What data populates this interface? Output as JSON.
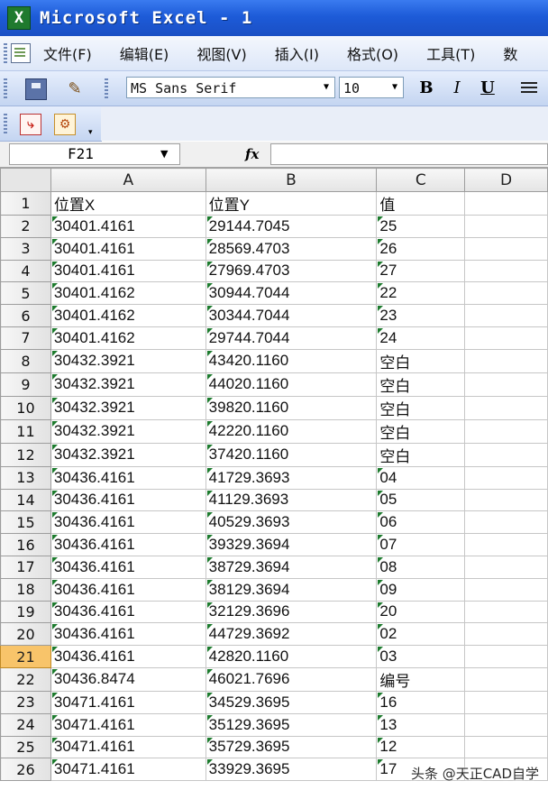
{
  "window": {
    "title": "Microsoft Excel - 1",
    "app_icon_letter": "X"
  },
  "menu": {
    "items": [
      {
        "key": "file",
        "label": "文件(F)"
      },
      {
        "key": "edit",
        "label": "编辑(E)"
      },
      {
        "key": "view",
        "label": "视图(V)"
      },
      {
        "key": "insert",
        "label": "插入(I)"
      },
      {
        "key": "format",
        "label": "格式(O)"
      },
      {
        "key": "tools",
        "label": "工具(T)"
      },
      {
        "key": "data",
        "label": "数"
      }
    ]
  },
  "toolbar": {
    "font_name": "MS Sans Serif",
    "font_size": "10",
    "bold_label": "B",
    "italic_label": "I",
    "underline_label": "U",
    "icons": [
      "save-icon",
      "format-painter-icon",
      "bold-icon",
      "italic-icon",
      "underline-icon",
      "align-icon",
      "pdf-convert-icon",
      "pdf-options-icon"
    ]
  },
  "formula_bar": {
    "name_box": "F21",
    "fx_label": "fx",
    "formula": ""
  },
  "sheet": {
    "columns": [
      "A",
      "B",
      "C",
      "D"
    ],
    "active_row": "21",
    "rows": [
      {
        "n": "1",
        "a": "位置X",
        "b": "位置Y",
        "c": "值",
        "d": "",
        "hdr": true
      },
      {
        "n": "2",
        "a": "30401.4161",
        "b": "29144.7045",
        "c": "25",
        "d": ""
      },
      {
        "n": "3",
        "a": "30401.4161",
        "b": "28569.4703",
        "c": "26",
        "d": ""
      },
      {
        "n": "4",
        "a": "30401.4161",
        "b": "27969.4703",
        "c": "27",
        "d": ""
      },
      {
        "n": "5",
        "a": "30401.4162",
        "b": "30944.7044",
        "c": "22",
        "d": ""
      },
      {
        "n": "6",
        "a": "30401.4162",
        "b": "30344.7044",
        "c": "23",
        "d": ""
      },
      {
        "n": "7",
        "a": "30401.4162",
        "b": "29744.7044",
        "c": "24",
        "d": ""
      },
      {
        "n": "8",
        "a": "30432.3921",
        "b": "43420.1160",
        "c": "空白",
        "d": ""
      },
      {
        "n": "9",
        "a": "30432.3921",
        "b": "44020.1160",
        "c": "空白",
        "d": ""
      },
      {
        "n": "10",
        "a": "30432.3921",
        "b": "39820.1160",
        "c": "空白",
        "d": ""
      },
      {
        "n": "11",
        "a": "30432.3921",
        "b": "42220.1160",
        "c": "空白",
        "d": ""
      },
      {
        "n": "12",
        "a": "30432.3921",
        "b": "37420.1160",
        "c": "空白",
        "d": ""
      },
      {
        "n": "13",
        "a": "30436.4161",
        "b": "41729.3693",
        "c": "04",
        "d": ""
      },
      {
        "n": "14",
        "a": "30436.4161",
        "b": "41129.3693",
        "c": "05",
        "d": ""
      },
      {
        "n": "15",
        "a": "30436.4161",
        "b": "40529.3693",
        "c": "06",
        "d": ""
      },
      {
        "n": "16",
        "a": "30436.4161",
        "b": "39329.3694",
        "c": "07",
        "d": ""
      },
      {
        "n": "17",
        "a": "30436.4161",
        "b": "38729.3694",
        "c": "08",
        "d": ""
      },
      {
        "n": "18",
        "a": "30436.4161",
        "b": "38129.3694",
        "c": "09",
        "d": ""
      },
      {
        "n": "19",
        "a": "30436.4161",
        "b": "32129.3696",
        "c": "20",
        "d": ""
      },
      {
        "n": "20",
        "a": "30436.4161",
        "b": "44729.3692",
        "c": "02",
        "d": ""
      },
      {
        "n": "21",
        "a": "30436.4161",
        "b": "42820.1160",
        "c": "03",
        "d": ""
      },
      {
        "n": "22",
        "a": "30436.8474",
        "b": "46021.7696",
        "c": "编号",
        "d": ""
      },
      {
        "n": "23",
        "a": "30471.4161",
        "b": "34529.3695",
        "c": "16",
        "d": ""
      },
      {
        "n": "24",
        "a": "30471.4161",
        "b": "35129.3695",
        "c": "13",
        "d": ""
      },
      {
        "n": "25",
        "a": "30471.4161",
        "b": "35729.3695",
        "c": "12",
        "d": ""
      },
      {
        "n": "26",
        "a": "30471.4161",
        "b": "33929.3695",
        "c": "17",
        "d": ""
      }
    ]
  },
  "watermark": "头条 @天正CAD自学"
}
